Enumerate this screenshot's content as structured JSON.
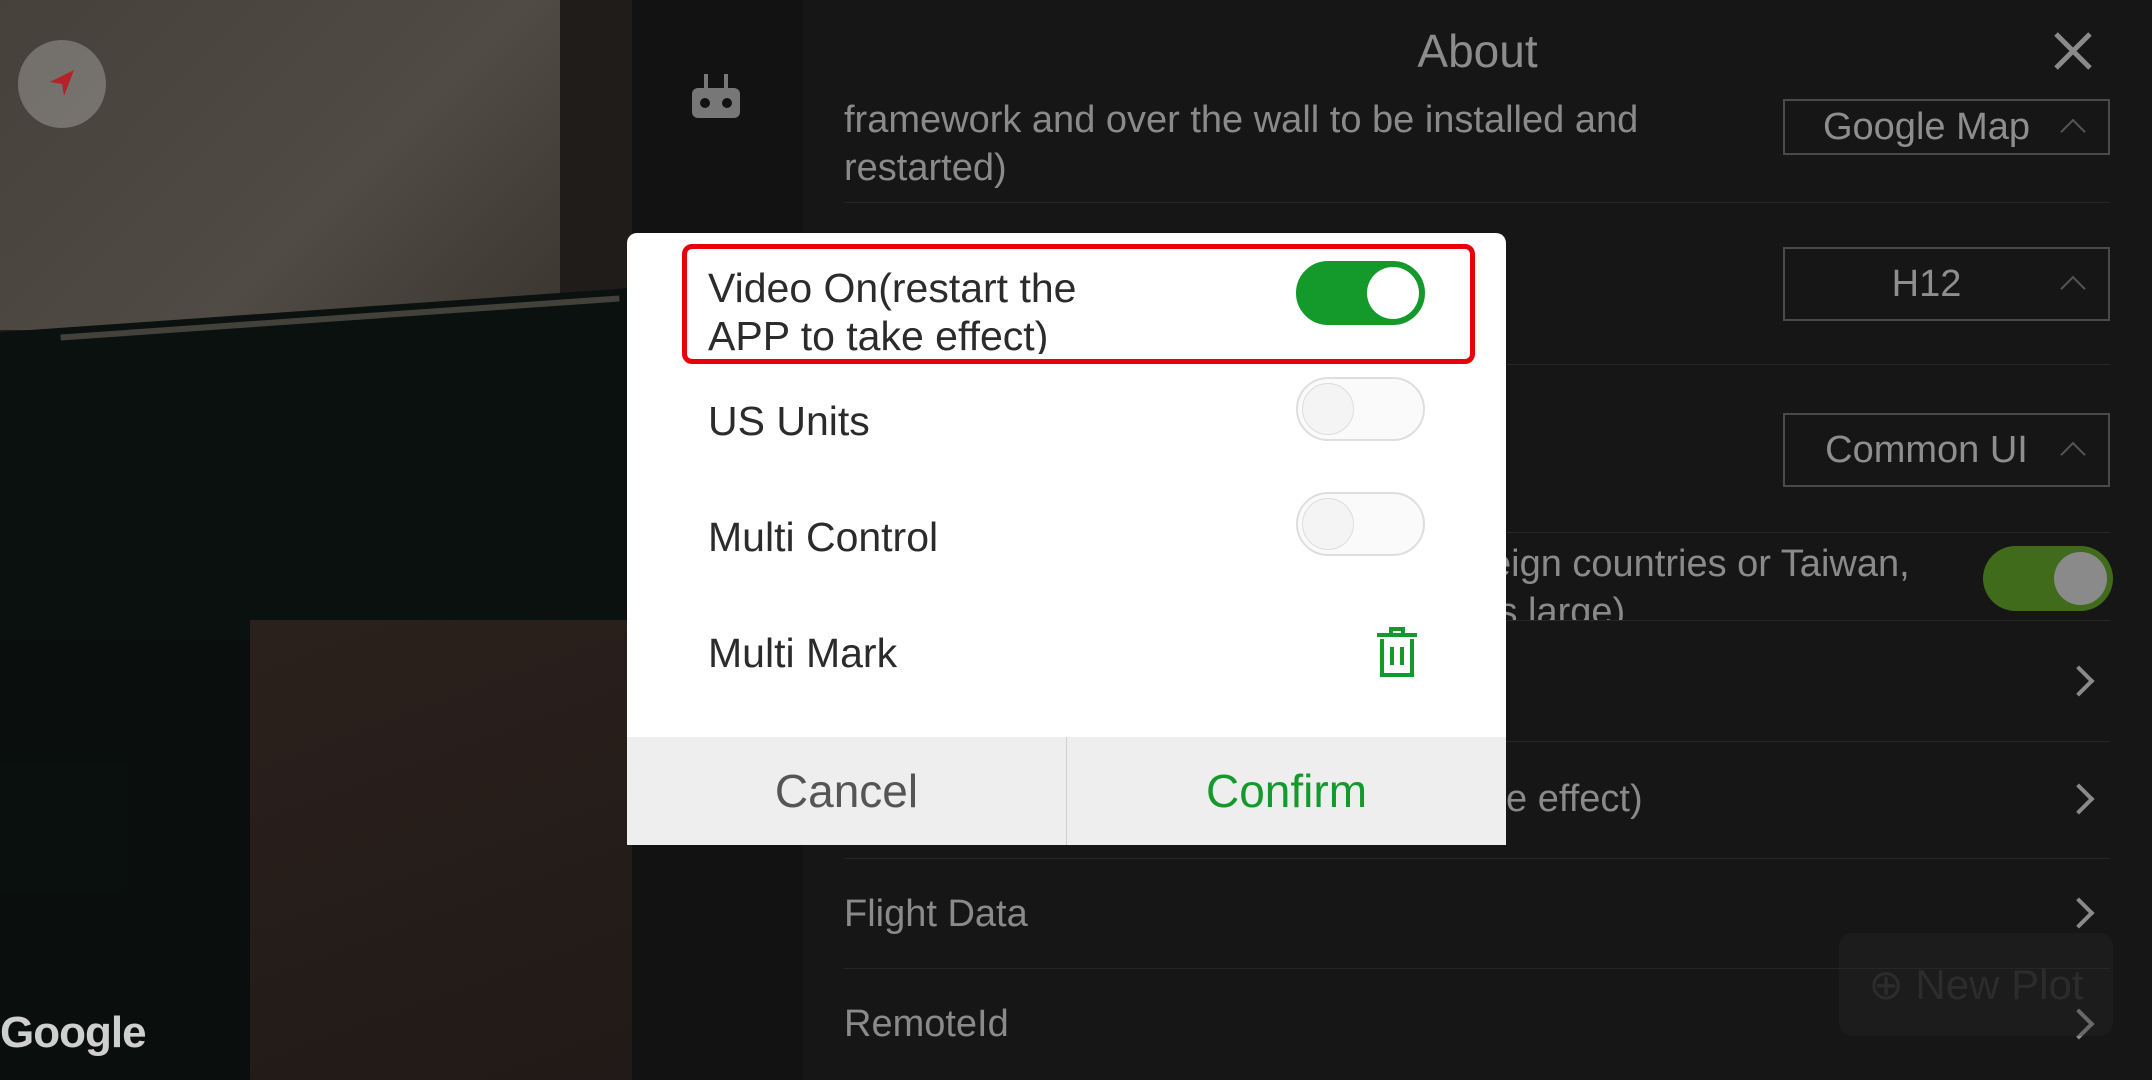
{
  "map": {
    "attribution": "Google"
  },
  "panel": {
    "title": "About",
    "rows": [
      {
        "text_line1": "framework and over the wall to be installed and",
        "text_line2": "restarted)",
        "dropdown": "Google Map"
      },
      {
        "dropdown": "H12"
      },
      {
        "dropdown": "Common UI"
      },
      {
        "text_line1": "eign countries or Taiwan,",
        "text_line2": "is large)",
        "toggle_on": true
      },
      {
        "text": ""
      },
      {
        "text": "e effect)"
      },
      {
        "text": "Flight Data"
      },
      {
        "text": "RemoteId"
      }
    ],
    "new_plot_label": "New Plot"
  },
  "dialog": {
    "items": [
      {
        "label_line1": "Video On(restart the",
        "label_line2": "APP to take effect)",
        "toggle_on": true
      },
      {
        "label": "US Units",
        "toggle_on": false
      },
      {
        "label": "Multi Control",
        "toggle_on": false
      },
      {
        "label": "Multi Mark",
        "icon": "trash-icon"
      }
    ],
    "cancel_label": "Cancel",
    "confirm_label": "Confirm"
  },
  "colors": {
    "accent": "#139a2b",
    "highlight": "#e8000b"
  }
}
